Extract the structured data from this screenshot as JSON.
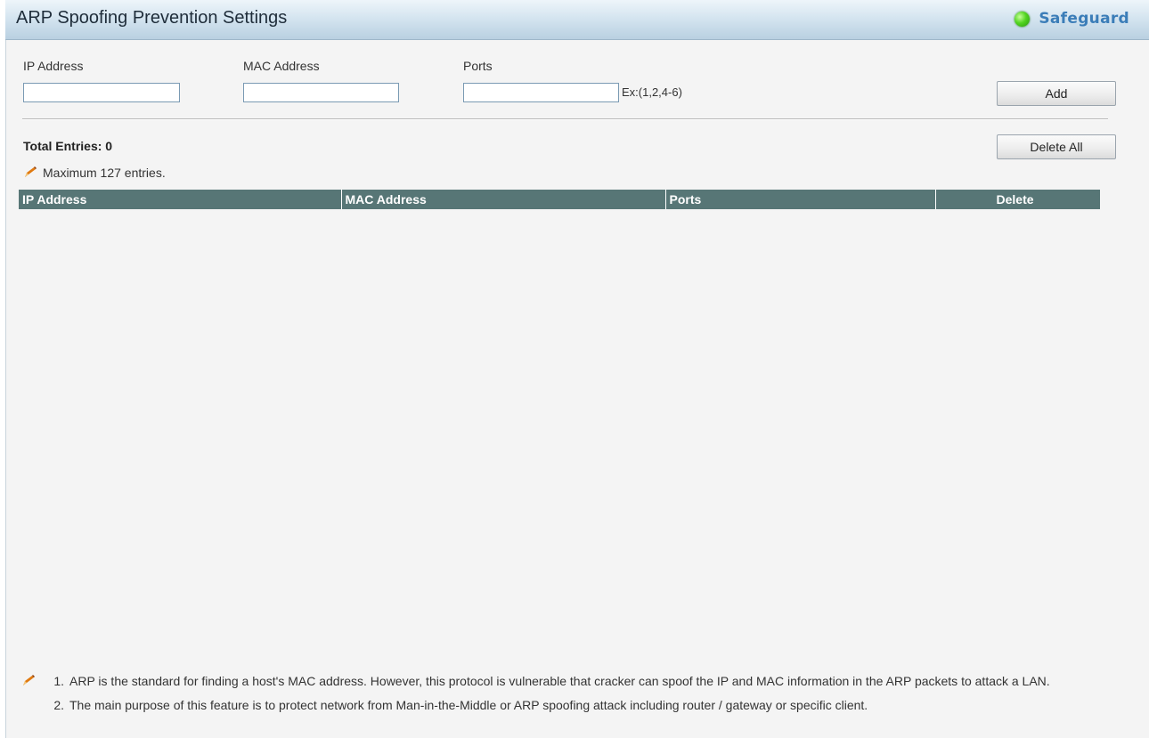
{
  "header": {
    "title": "ARP Spoofing Prevention Settings",
    "status_label": "Safeguard",
    "status_color": "#3fcf1a"
  },
  "form": {
    "ip_label": "IP Address",
    "ip_value": "",
    "mac_label": "MAC Address",
    "mac_value": "",
    "ports_label": "Ports",
    "ports_value": "",
    "ports_hint": "Ex:(1,2,4-6)",
    "add_label": "Add"
  },
  "summary": {
    "total_entries": "Total Entries: 0",
    "delete_all_label": "Delete All",
    "max_note": "Maximum 127 entries."
  },
  "table": {
    "columns": [
      "IP Address",
      "MAC Address",
      "Ports",
      "Delete"
    ],
    "rows": []
  },
  "notes": [
    {
      "num": "1.",
      "text": "ARP is the standard for finding a host's MAC address. However, this protocol is vulnerable that cracker can spoof the IP and MAC information in the ARP packets to attack a LAN."
    },
    {
      "num": "2.",
      "text": "The main purpose of this feature is to protect network from Man-in-the-Middle or ARP spoofing attack including router / gateway or specific client."
    }
  ],
  "icons": {
    "note_icon": "pencil-icon",
    "status_icon": "green-led-icon"
  }
}
